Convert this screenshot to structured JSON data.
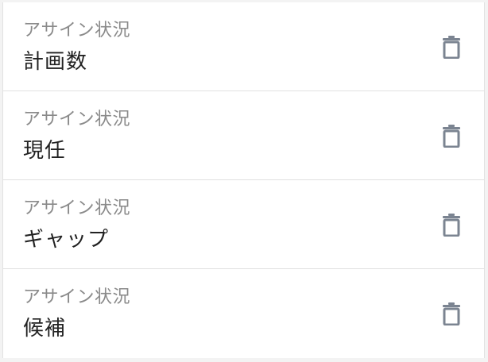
{
  "rows": [
    {
      "label": "アサイン状況",
      "value": "計画数",
      "action_icon": "trash-icon"
    },
    {
      "label": "アサイン状況",
      "value": "現任",
      "action_icon": "trash-icon"
    },
    {
      "label": "アサイン状況",
      "value": "ギャップ",
      "action_icon": "trash-icon"
    },
    {
      "label": "アサイン状況",
      "value": "候補",
      "action_icon": "trash-icon"
    }
  ],
  "colors": {
    "label": "#8a8a8a",
    "value": "#222222",
    "icon": "#7b8491",
    "divider": "#e0e0e0"
  }
}
